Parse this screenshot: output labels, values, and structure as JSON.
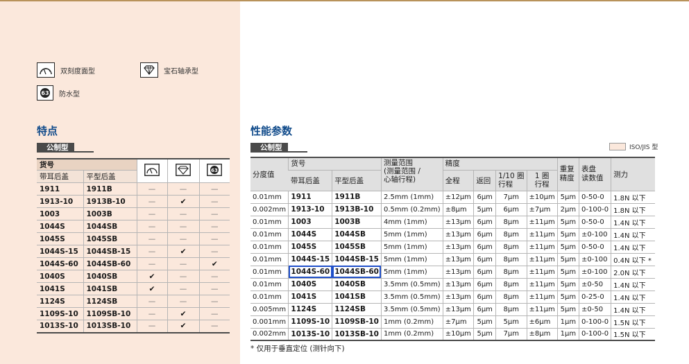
{
  "legend": {
    "dual_dial": "双刻度面型",
    "jewel": "宝石轴承型",
    "waterproof": "防水型",
    "waterproof_icon_text": "63"
  },
  "features": {
    "title": "特点",
    "tag": "公制型",
    "header": {
      "part_no": "货号",
      "lug_back": "带耳后盖",
      "flat_back": "平型后盖"
    },
    "rows": [
      {
        "a": "1911",
        "b": "1911B",
        "m1": "—",
        "m2": "—",
        "m3": "—"
      },
      {
        "a": "1913-10",
        "b": "1913B-10",
        "m1": "—",
        "m2": "✔",
        "m3": "—"
      },
      {
        "a": "1003",
        "b": "1003B",
        "m1": "—",
        "m2": "—",
        "m3": "—"
      },
      {
        "a": "1044S",
        "b": "1044SB",
        "m1": "—",
        "m2": "—",
        "m3": "—"
      },
      {
        "a": "1045S",
        "b": "1045SB",
        "m1": "—",
        "m2": "—",
        "m3": "—"
      },
      {
        "a": "1044S-15",
        "b": "1044SB-15",
        "m1": "—",
        "m2": "✔",
        "m3": "—"
      },
      {
        "a": "1044S-60",
        "b": "1044SB-60",
        "m1": "—",
        "m2": "—",
        "m3": "✔"
      },
      {
        "a": "1040S",
        "b": "1040SB",
        "m1": "✔",
        "m2": "—",
        "m3": "—"
      },
      {
        "a": "1041S",
        "b": "1041SB",
        "m1": "✔",
        "m2": "—",
        "m3": "—"
      },
      {
        "a": "1124S",
        "b": "1124SB",
        "m1": "—",
        "m2": "—",
        "m3": "—"
      },
      {
        "a": "1109S-10",
        "b": "1109SB-10",
        "m1": "—",
        "m2": "✔",
        "m3": "—"
      },
      {
        "a": "1013S-10",
        "b": "1013SB-10",
        "m1": "—",
        "m2": "✔",
        "m3": "—"
      }
    ]
  },
  "performance": {
    "title": "性能参数",
    "tag": "公制型",
    "iso_legend": "ISO/JIS 型",
    "header": {
      "graduation": "分度值",
      "part_no": "货号",
      "lug_back": "带耳后盖",
      "flat_back": "平型后盖",
      "range_l1": "测量范围",
      "range_l2": "(测量范围 /",
      "range_l3": "心轴行程)",
      "accuracy": "精度",
      "total": "全程",
      "retrace": "返回",
      "tenth_l1": "1/10 圈",
      "tenth_l2": "行程",
      "one_l1": "1 圈",
      "one_l2": "行程",
      "repeat_l1": "重复",
      "repeat_l2": "精度",
      "dial_l1": "表盘",
      "dial_l2": "读数值",
      "force": "测力"
    },
    "rows": [
      [
        "0.01mm",
        "1911",
        "1911B",
        "2.5mm (1mm)",
        "±12μm",
        "6μm",
        "7μm",
        "±10μm",
        "5μm",
        "0-50-0",
        "1.8N 以下"
      ],
      [
        "0.002mm",
        "1913-10",
        "1913B-10",
        "0.5mm (0.2mm)",
        "±8μm",
        "5μm",
        "6μm",
        "±7μm",
        "2μm",
        "0-100-0",
        "1.8N 以下"
      ],
      [
        "0.01mm",
        "1003",
        "1003B",
        "4mm (1mm)",
        "±13μm",
        "6μm",
        "8μm",
        "±11μm",
        "5μm",
        "0-50-0",
        "1.4N 以下"
      ],
      [
        "0.01mm",
        "1044S",
        "1044SB",
        "5mm (1mm)",
        "±13μm",
        "6μm",
        "8μm",
        "±11μm",
        "5μm",
        "±0-100",
        "1.4N 以下"
      ],
      [
        "0.01mm",
        "1045S",
        "1045SB",
        "5mm (1mm)",
        "±13μm",
        "6μm",
        "8μm",
        "±11μm",
        "5μm",
        "0-50-0",
        "1.4N 以下"
      ],
      [
        "0.01mm",
        "1044S-15",
        "1044SB-15",
        "5mm (1mm)",
        "±13μm",
        "6μm",
        "8μm",
        "±11μm",
        "5μm",
        "±0-100",
        "0.4N 以下 *"
      ],
      [
        "0.01mm",
        "1044S-60",
        "1044SB-60",
        "5mm (1mm)",
        "±13μm",
        "6μm",
        "8μm",
        "±11μm",
        "5μm",
        "±0-100",
        "2.0N 以下"
      ],
      [
        "0.01mm",
        "1040S",
        "1040SB",
        "3.5mm (0.5mm)",
        "±13μm",
        "6μm",
        "8μm",
        "±11μm",
        "5μm",
        "±0-50",
        "1.4N 以下"
      ],
      [
        "0.01mm",
        "1041S",
        "1041SB",
        "3.5mm (0.5mm)",
        "±13μm",
        "6μm",
        "8μm",
        "±11μm",
        "5μm",
        "0-25-0",
        "1.4N 以下"
      ],
      [
        "0.005mm",
        "1124S",
        "1124SB",
        "3.5mm (0.5mm)",
        "±13μm",
        "6μm",
        "8μm",
        "±11μm",
        "5μm",
        "±0-50",
        "1.4N 以下"
      ],
      [
        "0.001mm",
        "1109S-10",
        "1109SB-10",
        "1mm (0.2mm)",
        "±7μm",
        "5μm",
        "5μm",
        "±6μm",
        "1μm",
        "0-100-0",
        "1.5N 以下"
      ],
      [
        "0.002mm",
        "1013S-10",
        "1013SB-10",
        "1mm (0.2mm)",
        "±10μm",
        "5μm",
        "7μm",
        "±8μm",
        "1μm",
        "0-100-0",
        "1.5N 以下"
      ]
    ],
    "note": "* 仅用于垂直定位 (测针向下)"
  }
}
